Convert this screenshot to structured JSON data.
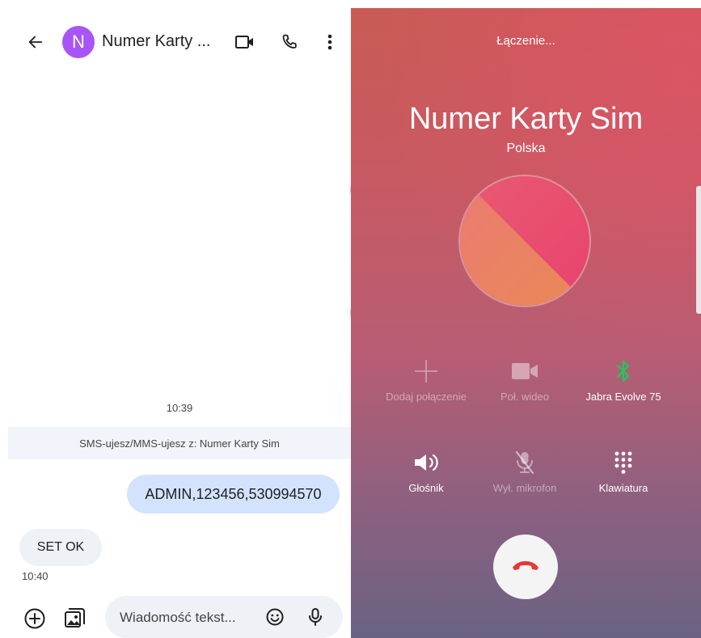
{
  "messages_app": {
    "contact_initial": "N",
    "contact_name": "Numer Karty ...",
    "avatar_color": "#a855f7",
    "day_timestamp": "10:39",
    "sms_banner": "SMS-ujesz/MMS-ujesz z: Numer Karty Sim",
    "messages": [
      {
        "direction": "outgoing",
        "text": "ADMIN,123456,530994570"
      },
      {
        "direction": "incoming",
        "text": "SET OK",
        "time": "10:40"
      }
    ],
    "compose_placeholder": "Wiadomość tekst...",
    "icons": [
      "back-arrow-icon",
      "video-call-icon",
      "phone-icon",
      "more-vert-icon",
      "add-circle-icon",
      "gallery-icon",
      "emoji-icon",
      "mic-icon"
    ]
  },
  "call_screen": {
    "status": "Łączenie...",
    "name": "Numer Karty Sim",
    "country": "Polska",
    "controls": [
      {
        "label": "Dodaj połączenie",
        "icon": "add-icon",
        "enabled": false
      },
      {
        "label": "Poł. wideo",
        "icon": "video-icon",
        "enabled": false
      },
      {
        "label": "Jabra Evolve 75",
        "icon": "bluetooth-icon",
        "enabled": true,
        "accent": "#22c55e"
      },
      {
        "label": "Głośnik",
        "icon": "speaker-icon",
        "enabled": true
      },
      {
        "label": "Wył. mikrofon",
        "icon": "mic-off-icon",
        "enabled": false
      },
      {
        "label": "Klawiatura",
        "icon": "dialpad-icon",
        "enabled": true
      }
    ],
    "end_call_color": "#e53935"
  }
}
